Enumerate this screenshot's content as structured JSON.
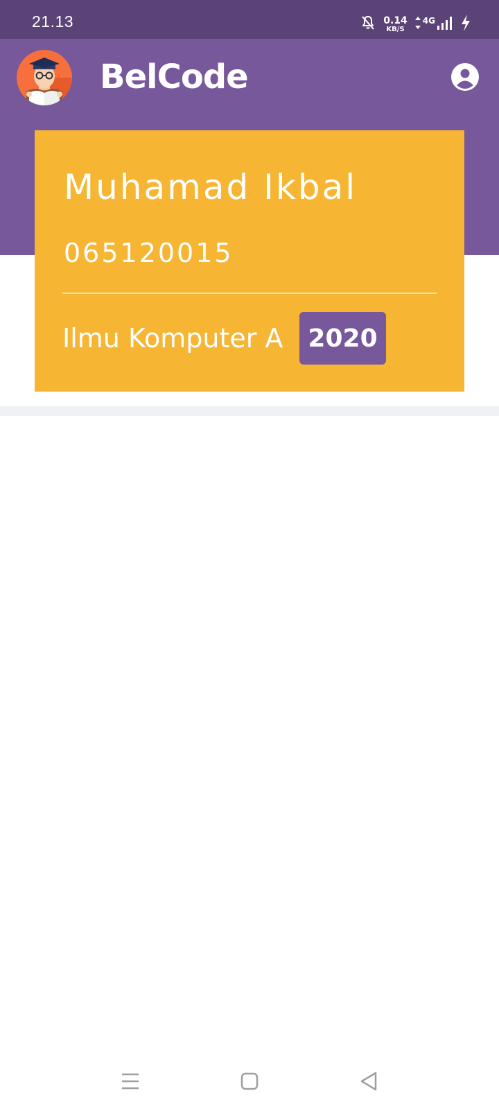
{
  "status_bar": {
    "time": "21.13",
    "network_speed": "0.14",
    "network_speed_unit": "KB/S",
    "network_type": "4G",
    "icons": [
      "bell-off-icon",
      "data-arrows-icon",
      "signal-icon",
      "charging-icon"
    ]
  },
  "header": {
    "app_title": "BelCode",
    "logo": "graduate-reading-logo",
    "profile_icon": "account-circle-icon"
  },
  "student_card": {
    "name": "Muhamad Ikbal",
    "student_id": "065120015",
    "program": "Ilmu Komputer A",
    "year": "2020"
  },
  "navigation_bar": {
    "buttons": [
      "menu-icon",
      "home-icon",
      "back-icon"
    ]
  },
  "colors": {
    "status_bar": "#5b4377",
    "header": "#76589b",
    "card": "#f6b633",
    "badge": "#76589b",
    "divider": "#eff1f4"
  }
}
